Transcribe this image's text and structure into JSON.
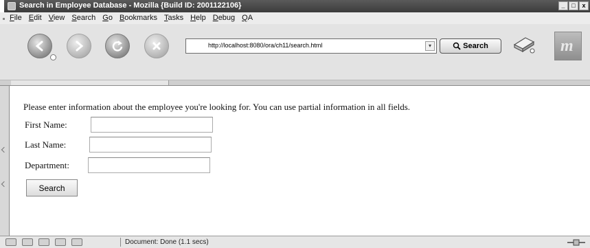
{
  "window": {
    "title": "Search in Employee Database - Mozilla {Build ID: 2001122106}",
    "controls": [
      "_",
      "□",
      "x"
    ]
  },
  "menu": [
    "File",
    "Edit",
    "View",
    "Search",
    "Go",
    "Bookmarks",
    "Tasks",
    "Help",
    "Debug",
    "QA"
  ],
  "toolbar": {
    "url": "http://localhost:8080/ora/ch11/search.html",
    "search_label": "Search",
    "icons": [
      "back-icon",
      "forward-icon",
      "reload-icon",
      "stop-icon",
      "print-icon",
      "throbber-icon"
    ]
  },
  "form": {
    "intro": "Please enter information about the employee you're looking for. You can use partial information in all fields.",
    "first_name_label": "First Name:",
    "last_name_label": "Last Name:",
    "department_label": "Department:",
    "first_name_value": "",
    "last_name_value": "",
    "department_value": "",
    "submit_label": "Search"
  },
  "status": {
    "message": "Document: Done (1.1 secs)"
  }
}
